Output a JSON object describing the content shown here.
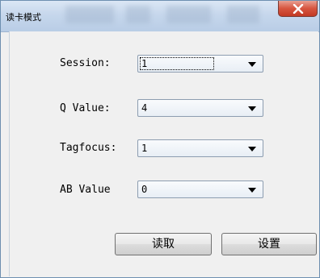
{
  "window": {
    "title": "读卡模式",
    "close_symbol": "X"
  },
  "form": {
    "session": {
      "label": "Session:",
      "value": "1"
    },
    "q_value": {
      "label": "Q Value:",
      "value": "4"
    },
    "tagfocus": {
      "label": "Tagfocus:",
      "value": "1"
    },
    "ab_value": {
      "label": "AB Value",
      "value": "0"
    }
  },
  "buttons": {
    "read_label": "读取",
    "set_label": "设置"
  },
  "colors": {
    "close_button": "#c23a24",
    "titlebar": "#c6d7ec",
    "client_bg": "#f0f0f0"
  }
}
